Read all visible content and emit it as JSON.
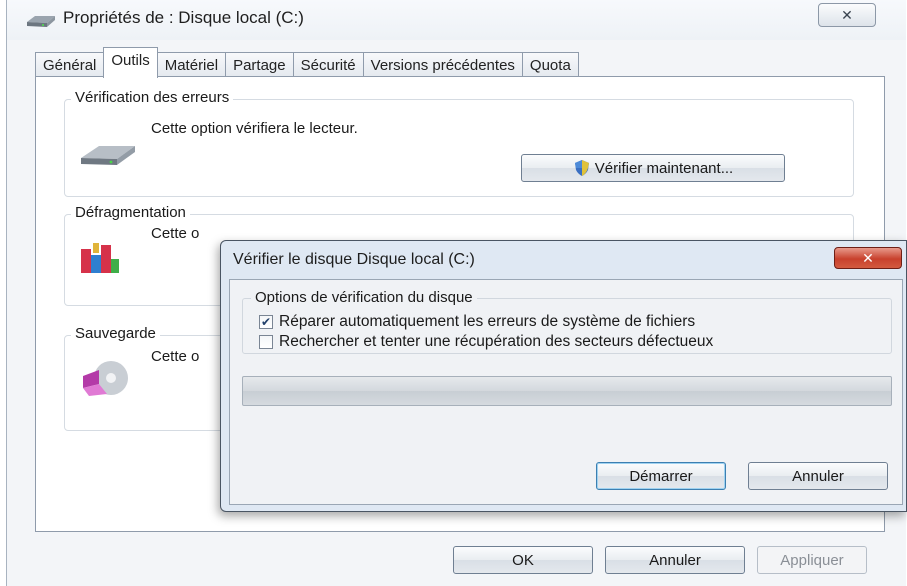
{
  "window": {
    "title": "Propriétés de : Disque local (C:)",
    "close_glyph": "✕",
    "icon": "drive-icon"
  },
  "tabs": [
    {
      "label": "Général",
      "active": false
    },
    {
      "label": "Outils",
      "active": true
    },
    {
      "label": "Matériel",
      "active": false
    },
    {
      "label": "Partage",
      "active": false
    },
    {
      "label": "Sécurité",
      "active": false
    },
    {
      "label": "Versions précédentes",
      "active": false
    },
    {
      "label": "Quota",
      "active": false
    }
  ],
  "error_checking": {
    "label": "Vérification des erreurs",
    "text": "Cette option vérifiera le lecteur.",
    "button": "Vérifier maintenant...",
    "icon": "hard-drive-icon",
    "button_icon": "uac-shield-icon"
  },
  "defrag": {
    "label": "Défragmentation",
    "text": "Cette o",
    "icon": "defrag-icon"
  },
  "backup": {
    "label": "Sauvegarde",
    "text": "Cette o",
    "icon": "backup-icon"
  },
  "footer": {
    "ok": "OK",
    "cancel": "Annuler",
    "apply": "Appliquer"
  },
  "dialog": {
    "title": "Vérifier le disque Disque local (C:)",
    "close_glyph": "✕",
    "group_label": "Options de vérification du disque",
    "options": [
      {
        "label": "Réparer automatiquement les erreurs de système de fichiers",
        "checked": true
      },
      {
        "label": "Rechercher et tenter une récupération des secteurs défectueux",
        "checked": false
      }
    ],
    "progress": 0,
    "start_button": "Démarrer",
    "cancel_button": "Annuler"
  },
  "colors": {
    "dialog_frame": "#dfe8f3",
    "close_red": "#c8412d",
    "focus_blue": "#3c7fb1"
  }
}
